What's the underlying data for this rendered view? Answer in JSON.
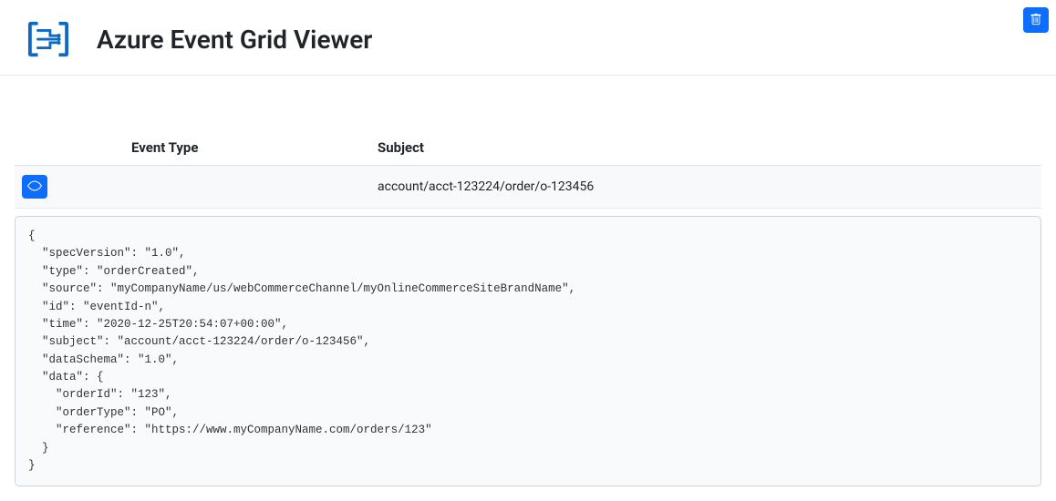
{
  "header": {
    "title": "Azure Event Grid Viewer"
  },
  "columns": {
    "event_type": "Event Type",
    "subject": "Subject"
  },
  "events": [
    {
      "type": "",
      "subject": "account/acct-123224/order/o-123456",
      "payload": "{\n  \"specVersion\": \"1.0\",\n  \"type\": \"orderCreated\",\n  \"source\": \"myCompanyName/us/webCommerceChannel/myOnlineCommerceSiteBrandName\",\n  \"id\": \"eventId-n\",\n  \"time\": \"2020-12-25T20:54:07+00:00\",\n  \"subject\": \"account/acct-123224/order/o-123456\",\n  \"dataSchema\": \"1.0\",\n  \"data\": {\n    \"orderId\": \"123\",\n    \"orderType\": \"PO\",\n    \"reference\": \"https://www.myCompanyName.com/orders/123\"\n  }\n}"
    }
  ]
}
